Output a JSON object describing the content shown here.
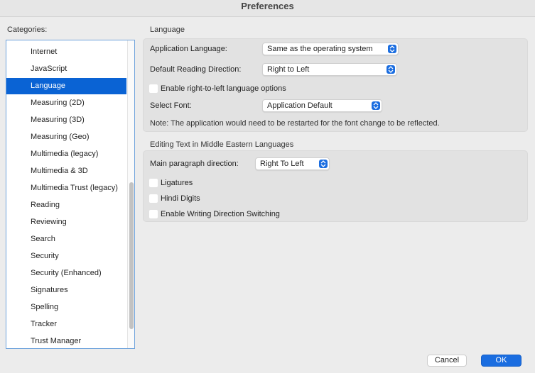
{
  "window": {
    "title": "Preferences"
  },
  "categories": {
    "label": "Categories:",
    "items": [
      {
        "label": "Internet"
      },
      {
        "label": "JavaScript"
      },
      {
        "label": "Language",
        "selected": true
      },
      {
        "label": "Measuring (2D)"
      },
      {
        "label": "Measuring (3D)"
      },
      {
        "label": "Measuring (Geo)"
      },
      {
        "label": "Multimedia (legacy)"
      },
      {
        "label": "Multimedia & 3D"
      },
      {
        "label": "Multimedia Trust (legacy)"
      },
      {
        "label": "Reading"
      },
      {
        "label": "Reviewing"
      },
      {
        "label": "Search"
      },
      {
        "label": "Security"
      },
      {
        "label": "Security (Enhanced)"
      },
      {
        "label": "Signatures"
      },
      {
        "label": "Spelling"
      },
      {
        "label": "Tracker"
      },
      {
        "label": "Trust Manager"
      }
    ]
  },
  "language": {
    "title": "Language",
    "app_language_label": "Application Language:",
    "app_language_value": "Same as the operating system",
    "reading_direction_label": "Default Reading Direction:",
    "reading_direction_value": "Right to Left",
    "rtl_options_label": "Enable right-to-left language options",
    "select_font_label": "Select Font:",
    "select_font_value": "Application Default",
    "note": "Note: The application would need to be restarted for the font change to be reflected."
  },
  "middle_eastern": {
    "title": "Editing Text in Middle Eastern Languages",
    "paragraph_direction_label": "Main paragraph direction:",
    "paragraph_direction_value": "Right To Left",
    "ligatures_label": "Ligatures",
    "hindi_digits_label": "Hindi Digits",
    "writing_direction_label": "Enable Writing Direction Switching"
  },
  "buttons": {
    "cancel": "Cancel",
    "ok": "OK"
  },
  "colors": {
    "accent": "#1a6de0",
    "selection": "#0a63d4"
  }
}
